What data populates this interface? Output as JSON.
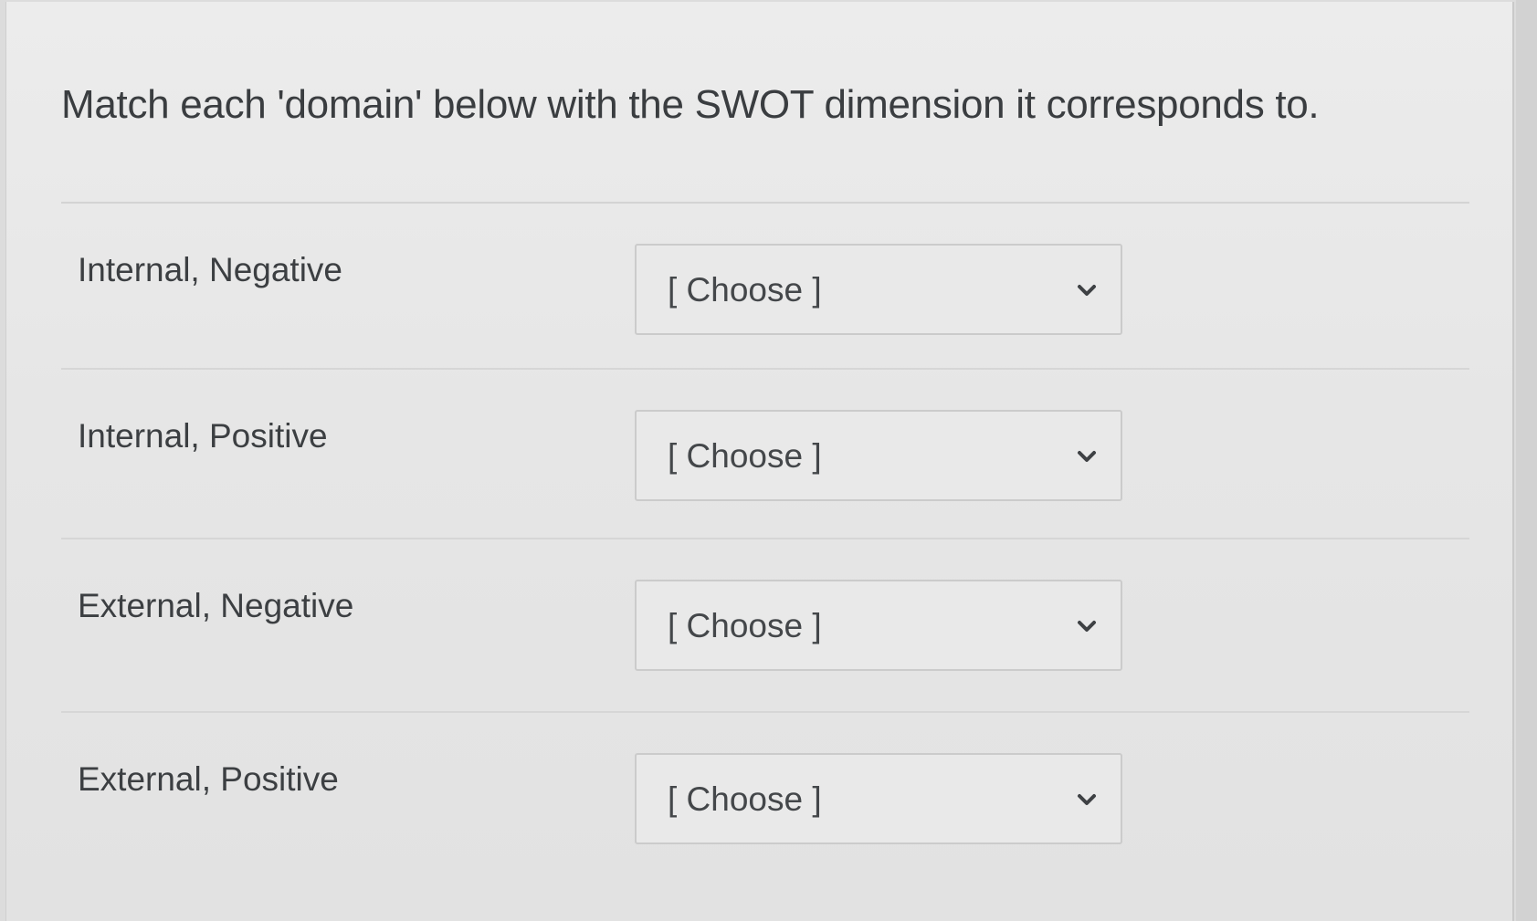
{
  "question": {
    "text": "Match each 'domain' below with the SWOT dimension it corresponds to."
  },
  "rows": [
    {
      "label": "Internal, Negative",
      "select_value": "[ Choose ]",
      "icon": "chevron-down-icon"
    },
    {
      "label": "Internal, Positive",
      "select_value": "[ Choose ]",
      "icon": "chevron-down-icon"
    },
    {
      "label": "External, Negative",
      "select_value": "[ Choose ]",
      "icon": "chevron-down-icon"
    },
    {
      "label": "External, Positive",
      "select_value": "[ Choose ]",
      "icon": "chevron-down-icon"
    }
  ],
  "colors": {
    "text": "#3a3d40",
    "border": "#cbcbcb",
    "background": "#e6e6e6"
  }
}
